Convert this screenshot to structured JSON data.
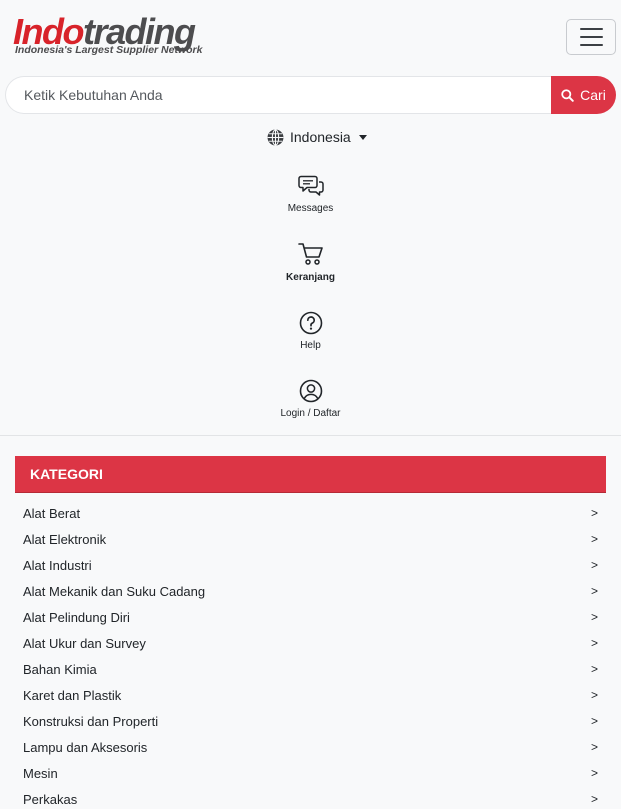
{
  "brand": {
    "logo_part1": "Indo",
    "logo_part2": "trading",
    "tagline": "Indonesia's Largest Supplier Network",
    "accent_color": "#dc3545"
  },
  "header": {
    "menu_icon": "hamburger-menu-icon"
  },
  "search": {
    "placeholder": "Ketik Kebutuhan Anda",
    "button_label": "Cari",
    "button_icon": "search-icon"
  },
  "language": {
    "selected": "Indonesia",
    "icon": "globe-icon"
  },
  "nav": [
    {
      "label": "Messages",
      "icon": "chat-bubbles-icon"
    },
    {
      "label": "Keranjang",
      "icon": "shopping-cart-icon"
    },
    {
      "label": "Help",
      "icon": "question-circle-icon"
    },
    {
      "label": "Login / Daftar",
      "icon": "user-circle-icon"
    }
  ],
  "categories": {
    "title": "KATEGORI",
    "chevron": ">",
    "items": [
      "Alat Berat",
      "Alat Elektronik",
      "Alat Industri",
      "Alat Mekanik dan Suku Cadang",
      "Alat Pelindung Diri",
      "Alat Ukur dan Survey",
      "Bahan Kimia",
      "Karet dan Plastik",
      "Konstruksi dan Properti",
      "Lampu dan Aksesoris",
      "Mesin",
      "Perkakas"
    ]
  }
}
